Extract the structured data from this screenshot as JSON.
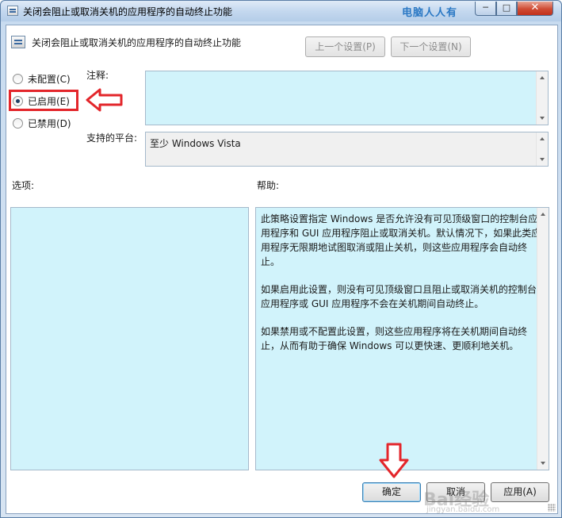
{
  "window": {
    "title": "关闭会阻止或取消关机的应用程序的自动终止功能",
    "watermark_top": "电脑人人有",
    "min_label": "─",
    "max_label": "□",
    "close_label": "✕"
  },
  "header": {
    "title": "关闭会阻止或取消关机的应用程序的自动终止功能",
    "prev_label": "上一个设置(P)",
    "next_label": "下一个设置(N)"
  },
  "state": {
    "options": [
      {
        "label": "未配置(C)",
        "selected": false
      },
      {
        "label": "已启用(E)",
        "selected": true
      },
      {
        "label": "已禁用(D)",
        "selected": false
      }
    ]
  },
  "comment": {
    "label": "注释:",
    "value": ""
  },
  "platform": {
    "label": "支持的平台:",
    "value": "至少 Windows Vista"
  },
  "options_section": {
    "label": "选项:"
  },
  "help_section": {
    "label": "帮助:",
    "paragraphs": [
      "此策略设置指定 Windows 是否允许没有可见顶级窗口的控制台应用程序和 GUI 应用程序阻止或取消关机。默认情况下，如果此类应用程序无限期地试图取消或阻止关机，则这些应用程序会自动终止。",
      "如果启用此设置，则没有可见顶级窗口且阻止或取消关机的控制台应用程序或 GUI 应用程序不会在关机期间自动终止。",
      "如果禁用或不配置此设置，则这些应用程序将在关机期间自动终止，从而有助于确保 Windows 可以更快速、更顺利地关机。"
    ]
  },
  "footer": {
    "ok_label": "确定",
    "cancel_label": "取消",
    "apply_label": "应用(A)",
    "watermark": "Bai经验",
    "watermark_sub": "jingyan.baidu.com"
  },
  "colors": {
    "annotation_red": "#e3262b",
    "textbox_fill": "#d1f3fb"
  }
}
